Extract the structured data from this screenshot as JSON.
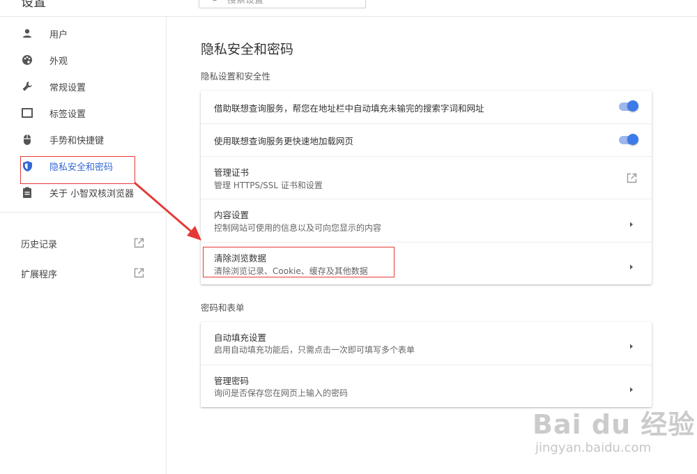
{
  "app": {
    "title": "设置"
  },
  "search": {
    "placeholder": "搜索设置"
  },
  "sidebar": {
    "items": [
      {
        "label": "用户",
        "icon": "person-icon"
      },
      {
        "label": "外观",
        "icon": "palette-icon"
      },
      {
        "label": "常规设置",
        "icon": "wrench-icon"
      },
      {
        "label": "标签设置",
        "icon": "tab-icon"
      },
      {
        "label": "手势和快捷键",
        "icon": "mouse-icon"
      },
      {
        "label": "隐私安全和密码",
        "icon": "shield-icon",
        "active": true
      },
      {
        "label": "关于 小智双核浏览器",
        "icon": "clipboard-icon"
      }
    ],
    "external": [
      {
        "label": "历史记录",
        "icon": "open-external-icon"
      },
      {
        "label": "扩展程序",
        "icon": "open-external-icon"
      }
    ]
  },
  "main": {
    "title": "隐私安全和密码",
    "sections": [
      {
        "title": "隐私设置和安全性",
        "rows": [
          {
            "primary": "借助联想查询服务，帮您在地址栏中自动填充未输完的搜索字词和网址",
            "control": "toggle",
            "enabled": true
          },
          {
            "primary": "使用联想查询服务更快速地加载网页",
            "control": "toggle",
            "enabled": true
          },
          {
            "primary": "管理证书",
            "secondary": "管理 HTTPS/SSL 证书和设置",
            "control": "open-external-icon"
          },
          {
            "primary": "内容设置",
            "secondary": "控制网站可使用的信息以及可向您显示的内容",
            "control": "chevron-right-icon"
          },
          {
            "primary": "清除浏览数据",
            "secondary": "清除浏览记录、Cookie、缓存及其他数据",
            "control": "chevron-right-icon"
          }
        ]
      },
      {
        "title": "密码和表单",
        "rows": [
          {
            "primary": "自动填充设置",
            "secondary": "启用自动填充功能后，只需点击一次即可填写多个表单",
            "control": "chevron-right-icon"
          },
          {
            "primary": "管理密码",
            "secondary": "询问是否保存您在网页上输入的密码",
            "control": "chevron-right-icon"
          }
        ]
      }
    ]
  },
  "colors": {
    "accent": "#3367d6",
    "toggle_on": "#3c7ae8",
    "annotation": "#e53935"
  },
  "watermark": {
    "brand": "Bai du 经验",
    "url": "jingyan.baidu.com"
  }
}
